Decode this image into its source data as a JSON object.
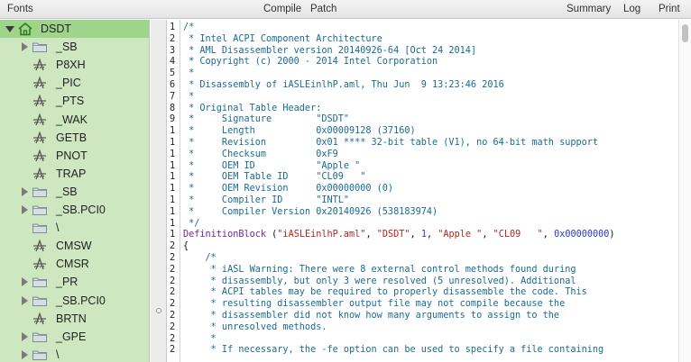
{
  "toolbar": {
    "fonts_label": "Fonts",
    "compile_label": "Compile",
    "patch_label": "Patch",
    "summary_label": "Summary",
    "log_label": "Log",
    "print_label": "Print"
  },
  "sidebar": {
    "items": [
      {
        "label": "DSDT",
        "kind": "home",
        "disclosure": "open",
        "selected": true
      },
      {
        "label": "_SB",
        "kind": "folder",
        "disclosure": "closed"
      },
      {
        "label": "P8XH",
        "kind": "method"
      },
      {
        "label": "_PIC",
        "kind": "method"
      },
      {
        "label": "_PTS",
        "kind": "method"
      },
      {
        "label": "_WAK",
        "kind": "method"
      },
      {
        "label": "GETB",
        "kind": "method"
      },
      {
        "label": "PNOT",
        "kind": "method"
      },
      {
        "label": "TRAP",
        "kind": "method"
      },
      {
        "label": "_SB",
        "kind": "folder",
        "disclosure": "closed"
      },
      {
        "label": "_SB.PCI0",
        "kind": "folder",
        "disclosure": "closed"
      },
      {
        "label": "\\",
        "kind": "folder"
      },
      {
        "label": "CMSW",
        "kind": "method"
      },
      {
        "label": "CMSR",
        "kind": "method"
      },
      {
        "label": "_PR",
        "kind": "folder",
        "disclosure": "closed"
      },
      {
        "label": "_SB.PCI0",
        "kind": "folder",
        "disclosure": "closed"
      },
      {
        "label": "BRTN",
        "kind": "method"
      },
      {
        "label": "_GPE",
        "kind": "folder",
        "disclosure": "closed"
      },
      {
        "label": "\\",
        "kind": "folder",
        "disclosure": "closed"
      }
    ]
  },
  "editor": {
    "lines": [
      {
        "n": "1",
        "segs": [
          {
            "t": "/*",
            "c": "cm"
          }
        ]
      },
      {
        "n": "2",
        "segs": [
          {
            "t": " * Intel ACPI Component Architecture",
            "c": "cm"
          }
        ]
      },
      {
        "n": "3",
        "segs": [
          {
            "t": " * AML Disassembler version 20140926-64 [Oct 24 2014]",
            "c": "cm"
          }
        ]
      },
      {
        "n": "4",
        "segs": [
          {
            "t": " * Copyright (c) 2000 - 2014 Intel Corporation",
            "c": "cm"
          }
        ]
      },
      {
        "n": "5",
        "segs": [
          {
            "t": " *",
            "c": "cm"
          }
        ]
      },
      {
        "n": "6",
        "segs": [
          {
            "t": " * Disassembly of iASLEinlhP.aml, Thu Jun  9 13:23:46 2016",
            "c": "cm"
          }
        ]
      },
      {
        "n": "7",
        "segs": [
          {
            "t": " *",
            "c": "cm"
          }
        ]
      },
      {
        "n": "8",
        "segs": [
          {
            "t": " * Original Table Header:",
            "c": "cm"
          }
        ]
      },
      {
        "n": "9",
        "segs": [
          {
            "t": " *     Signature        \"DSDT\"",
            "c": "cm"
          }
        ]
      },
      {
        "n": "1",
        "segs": [
          {
            "t": " *     Length           0x00009128 (37160)",
            "c": "cm"
          }
        ]
      },
      {
        "n": "1",
        "segs": [
          {
            "t": " *     Revision         0x01 **** 32-bit table (V1), no 64-bit math support",
            "c": "cm"
          }
        ]
      },
      {
        "n": "1",
        "segs": [
          {
            "t": " *     Checksum         0xF9",
            "c": "cm"
          }
        ]
      },
      {
        "n": "1",
        "segs": [
          {
            "t": " *     OEM ID           \"Apple \"",
            "c": "cm"
          }
        ]
      },
      {
        "n": "1",
        "segs": [
          {
            "t": " *     OEM Table ID     \"CL09   \"",
            "c": "cm"
          }
        ]
      },
      {
        "n": "1",
        "segs": [
          {
            "t": " *     OEM Revision     0x00000000 (0)",
            "c": "cm"
          }
        ]
      },
      {
        "n": "1",
        "segs": [
          {
            "t": " *     Compiler ID      \"INTL\"",
            "c": "cm"
          }
        ]
      },
      {
        "n": "1",
        "segs": [
          {
            "t": " *     Compiler Version 0x20140926 (538183974)",
            "c": "cm"
          }
        ]
      },
      {
        "n": "1",
        "segs": [
          {
            "t": " */",
            "c": "cm"
          }
        ]
      },
      {
        "n": "1",
        "segs": [
          {
            "t": "DefinitionBlock",
            "c": "kw"
          },
          {
            "t": " (",
            "c": "pl"
          },
          {
            "t": "\"iASLEinlhP.aml\"",
            "c": "str"
          },
          {
            "t": ", ",
            "c": "pl"
          },
          {
            "t": "\"DSDT\"",
            "c": "str"
          },
          {
            "t": ", ",
            "c": "pl"
          },
          {
            "t": "1",
            "c": "num"
          },
          {
            "t": ", ",
            "c": "pl"
          },
          {
            "t": "\"Apple \"",
            "c": "str"
          },
          {
            "t": ", ",
            "c": "pl"
          },
          {
            "t": "\"CL09   \"",
            "c": "str"
          },
          {
            "t": ", ",
            "c": "pl"
          },
          {
            "t": "0x00000000",
            "c": "num"
          },
          {
            "t": ")",
            "c": "pl"
          }
        ]
      },
      {
        "n": "2",
        "segs": [
          {
            "t": "{",
            "c": "pl"
          }
        ]
      },
      {
        "n": "2",
        "segs": [
          {
            "t": "    /*",
            "c": "cm"
          }
        ]
      },
      {
        "n": "2",
        "segs": [
          {
            "t": "     * iASL Warning: There were 8 external control methods found during",
            "c": "cm"
          }
        ]
      },
      {
        "n": "2",
        "segs": [
          {
            "t": "     * disassembly, but only 3 were resolved (5 unresolved). Additional",
            "c": "cm"
          }
        ]
      },
      {
        "n": "2",
        "segs": [
          {
            "t": "     * ACPI tables may be required to properly disassemble the code. This",
            "c": "cm"
          }
        ]
      },
      {
        "n": "2",
        "segs": [
          {
            "t": "     * resulting disassembler output file may not compile because the",
            "c": "cm"
          }
        ]
      },
      {
        "n": "2",
        "segs": [
          {
            "t": "     * disassembler did not know how many arguments to assign to the",
            "c": "cm"
          }
        ]
      },
      {
        "n": "2",
        "segs": [
          {
            "t": "     * unresolved methods.",
            "c": "cm"
          }
        ]
      },
      {
        "n": "2",
        "segs": [
          {
            "t": "     *",
            "c": "cm"
          }
        ]
      },
      {
        "n": "2",
        "segs": [
          {
            "t": "     * If necessary, the -fe option can be used to specify a file containing",
            "c": "cm"
          }
        ]
      }
    ]
  }
}
